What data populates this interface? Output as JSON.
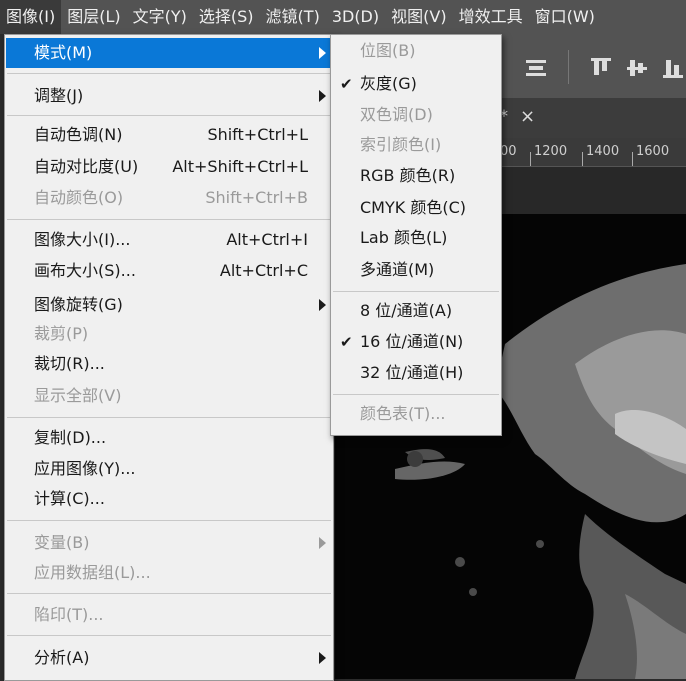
{
  "menubar": [
    "图像(I)",
    "图层(L)",
    "文字(Y)",
    "选择(S)",
    "滤镜(T)",
    "3D(D)",
    "视图(V)",
    "增效工具",
    "窗口(W)"
  ],
  "tab": {
    "modified_mark": "*",
    "close": "×"
  },
  "ruler": [
    "00",
    "1200",
    "1400",
    "1600"
  ],
  "image_menu": {
    "mode": "模式(M)",
    "adjust": "调整(J)",
    "auto_tone": {
      "label": "自动色调(N)",
      "shortcut": "Shift+Ctrl+L"
    },
    "auto_contrast": {
      "label": "自动对比度(U)",
      "shortcut": "Alt+Shift+Ctrl+L"
    },
    "auto_color": {
      "label": "自动颜色(O)",
      "shortcut": "Shift+Ctrl+B"
    },
    "image_size": {
      "label": "图像大小(I)...",
      "shortcut": "Alt+Ctrl+I"
    },
    "canvas_size": {
      "label": "画布大小(S)...",
      "shortcut": "Alt+Ctrl+C"
    },
    "rotation": "图像旋转(G)",
    "crop": "裁剪(P)",
    "trim": "裁切(R)...",
    "reveal_all": "显示全部(V)",
    "duplicate": "复制(D)...",
    "apply_image": "应用图像(Y)...",
    "calculations": "计算(C)...",
    "variables": "变量(B)",
    "apply_dataset": "应用数据组(L)...",
    "trap": "陷印(T)...",
    "analysis": "分析(A)"
  },
  "mode_menu": {
    "bitmap": "位图(B)",
    "grayscale": "灰度(G)",
    "duotone": "双色调(D)",
    "indexed": "索引颜色(I)",
    "rgb": "RGB 颜色(R)",
    "cmyk": "CMYK 颜色(C)",
    "lab": "Lab 颜色(L)",
    "multichannel": "多通道(M)",
    "bit8": "8 位/通道(A)",
    "bit16": "16 位/通道(N)",
    "bit32": "32 位/通道(H)",
    "color_table": "颜色表(T)..."
  },
  "checkmark": "✔"
}
